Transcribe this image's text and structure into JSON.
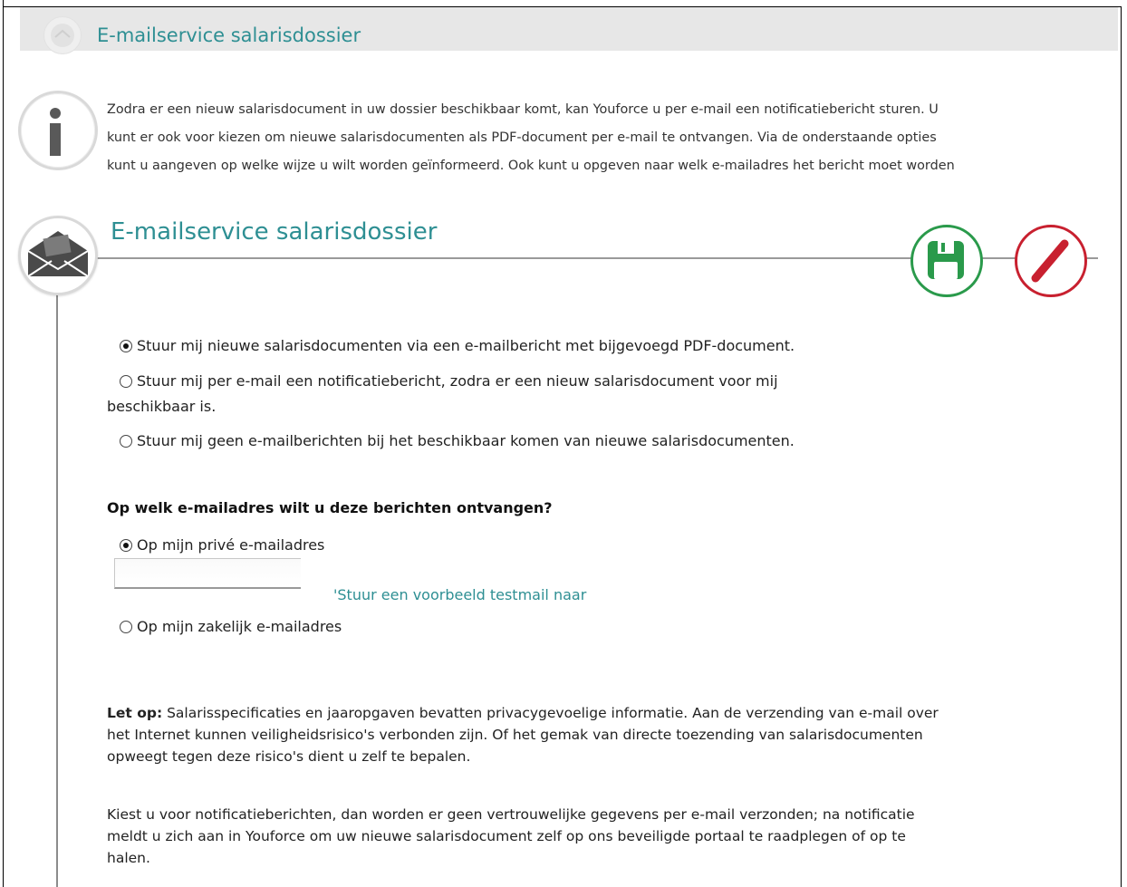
{
  "header": {
    "title": "E-mailservice salarisdossier"
  },
  "info": {
    "lines": [
      "Zodra er een nieuw salarisdocument in uw dossier beschikbaar komt, kan Youforce u per e-mail een notificatiebericht sturen. U",
      "kunt er ook voor kiezen om nieuwe salarisdocumenten als PDF-document per e-mail te ontvangen. Via de onderstaande opties",
      "kunt u aangeven op welke wijze u wilt worden geïnformeerd. Ook kunt u opgeven naar welk e-mailadres het bericht moet worden"
    ]
  },
  "section": {
    "title": "E-mailservice salarisdossier"
  },
  "delivery_options": {
    "option1": "Stuur mij nieuwe salarisdocumenten via een e-mailbericht met bijgevoegd PDF-document.",
    "option2_line1": "Stuur mij per e-mail een notificatiebericht, zodra er een nieuw salarisdocument voor mij",
    "option2_line2": "beschikbaar is.",
    "option3": "Stuur mij geen e-mailberichten bij het beschikbaar komen van nieuwe salarisdocumenten.",
    "selected": "option1"
  },
  "address": {
    "question": "Op welk e-mailadres wilt u deze berichten ontvangen?",
    "private_label": "Op mijn privé e-mailadres",
    "private_value": "",
    "testmail_link": "'Stuur een voorbeeld testmail naar",
    "business_label": "Op mijn zakelijk e-mailadres",
    "selected": "private"
  },
  "notice": {
    "bold_prefix": "Let op:",
    "para1_line1": " Salarisspecificaties en jaaropgaven bevatten privacygevoelige informatie. Aan de verzending van e-mail over",
    "para1_line2": "het Internet kunnen veiligheidsrisico's verbonden zijn. Of het gemak van directe toezending van salarisdocumenten",
    "para1_line3": "opweegt tegen deze risico's dient u zelf te bepalen.",
    "para2_line1": "Kiest u voor notificatieberichten, dan worden er geen vertrouwelijke gegevens per e-mail verzonden; na notificatie",
    "para2_line2": "meldt u zich aan in Youforce om uw nieuwe salarisdocument zelf op ons beveiligde portaal te raadplegen of op te",
    "para2_line3": "halen."
  },
  "colors": {
    "accent": "#2e8f93",
    "save": "#2a9a4b",
    "cancel": "#c8202f"
  },
  "icons": {
    "title": "envelope-logo-icon",
    "info": "info-icon",
    "section": "envelope-icon",
    "save": "floppy-disk-icon",
    "cancel": "pencil-slash-icon"
  }
}
